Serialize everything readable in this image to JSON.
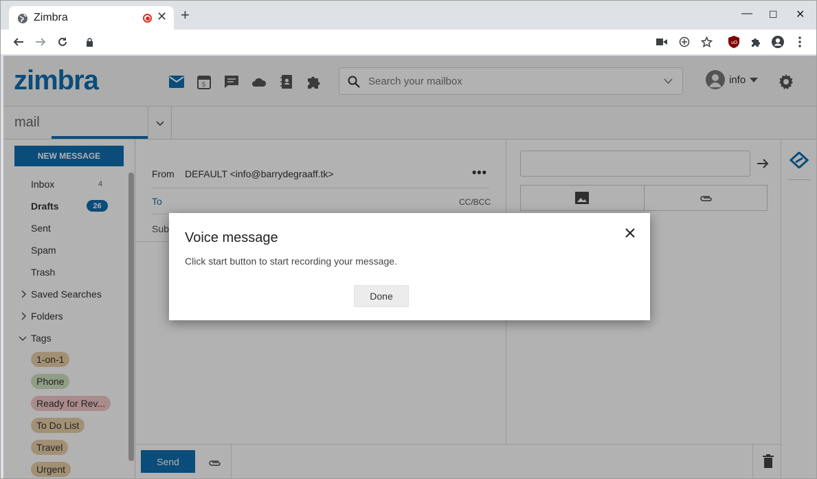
{
  "browser": {
    "tab_title": "Zimbra",
    "tab_close": "✕",
    "new_tab": "+",
    "min": "—",
    "max": "☐",
    "close": "✕"
  },
  "app": {
    "logo": "zimbra",
    "search_placeholder": "Search your mailbox",
    "user_name": "info",
    "section": "mail",
    "new_message": "NEW MESSAGE",
    "folders": [
      {
        "label": "Inbox",
        "count": "4"
      },
      {
        "label": "Drafts",
        "count": "26"
      },
      {
        "label": "Sent"
      },
      {
        "label": "Spam"
      },
      {
        "label": "Trash"
      },
      {
        "label": "Saved Searches"
      },
      {
        "label": "Folders"
      },
      {
        "label": "Tags"
      }
    ],
    "tags": [
      {
        "label": "1-on-1",
        "color": "#e8cfa8"
      },
      {
        "label": "Phone",
        "color": "#cfe3bf"
      },
      {
        "label": "Ready for Rev...",
        "color": "#f2c7c7"
      },
      {
        "label": "To Do List",
        "color": "#e8cfa8"
      },
      {
        "label": "Travel",
        "color": "#e8cfa8"
      },
      {
        "label": "Urgent",
        "color": "#e8cfa8"
      }
    ],
    "compose": {
      "from_label": "From",
      "from_value": "DEFAULT <info@barrydegraaff.tk>",
      "more": "•••",
      "to_label": "To",
      "ccbcc": "CC/BCC",
      "subject_label": "Sub"
    },
    "send": "Send"
  },
  "dialog": {
    "title": "Voice message",
    "message": "Click start button to start recording your message.",
    "done": "Done"
  },
  "colors": {
    "accent": "#0f6daf"
  }
}
